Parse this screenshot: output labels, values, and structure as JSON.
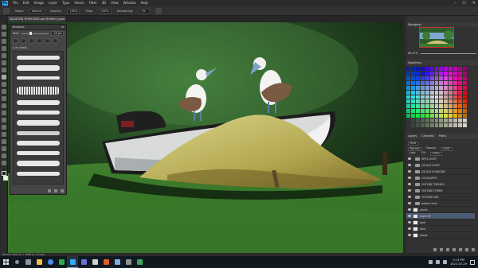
{
  "menubar": {
    "logo": "Ps",
    "items": [
      "File",
      "Edit",
      "Image",
      "Layer",
      "Type",
      "Select",
      "Filter",
      "3D",
      "View",
      "Window",
      "Help"
    ],
    "controls": [
      "–",
      "☐",
      "✕"
    ]
  },
  "options": {
    "mode_label": "Mode:",
    "mode_value": "Normal",
    "opacity_label": "Opacity:",
    "opacity_value": "100%",
    "flow_label": "Flow:",
    "flow_value": "100%",
    "smoothing_label": "Smoothing:",
    "smoothing_value": "0%"
  },
  "document": {
    "tab_title": "VACATION TRIPHOUSE.psd @ 66% (Layer 67, RGB/8) *",
    "status": "66.67%   3000 px x 1688 px (72 ppi)"
  },
  "brush_panel": {
    "title": "Brushes",
    "size_label": "Size:",
    "size_value": "23 px",
    "folder": "▸ ★ cchalk"
  },
  "dock": {
    "navigator_title": "Navigator",
    "zoom_pct": "66.67%",
    "swatches_title": "Swatches",
    "layers_tabs": [
      "Layers",
      "Channels",
      "Paths"
    ],
    "kind_label": "Kind",
    "blend_mode": "Normal",
    "opacity_label": "Opacity:",
    "opacity_value": "100%",
    "lock_label": "Lock:",
    "fill_label": "Fill:",
    "fill_value": "100%"
  },
  "layers": [
    {
      "name": "SPOT LIGHT",
      "kind": "folder"
    },
    {
      "name": "LOCALS LIGHT",
      "kind": "folder"
    },
    {
      "name": "LOCALS SHADOWS",
      "kind": "folder"
    },
    {
      "name": "LOCALS/EFX",
      "kind": "folder"
    },
    {
      "name": "OUTSIDE TWEAKS",
      "kind": "folder"
    },
    {
      "name": "OUTSIDE FORMS",
      "kind": "folder"
    },
    {
      "name": "OUTSIDE DAY",
      "kind": "folder"
    },
    {
      "name": "bottom level",
      "kind": "folder"
    },
    {
      "name": "plants",
      "kind": "layer"
    },
    {
      "name": "Layer 67",
      "kind": "layer",
      "selected": true
    },
    {
      "name": "boat",
      "kind": "layer"
    },
    {
      "name": "fond",
      "kind": "layer"
    },
    {
      "name": "shade",
      "kind": "layer"
    }
  ],
  "taskbar": {
    "time": "2:13 PM",
    "date": "2021-07-29"
  },
  "colors": {
    "accent": "#31a8ff",
    "selected_layer": "#4b5b71"
  }
}
